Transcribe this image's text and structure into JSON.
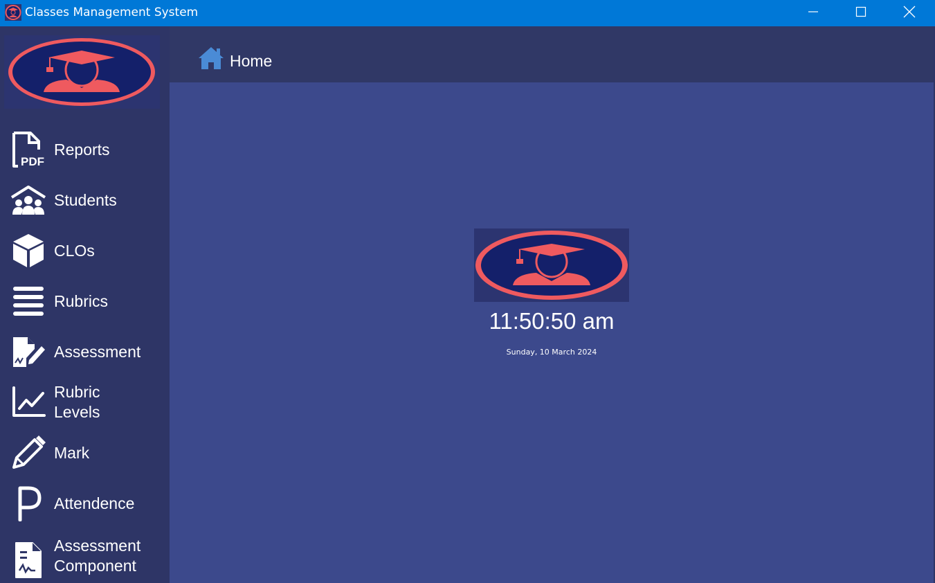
{
  "window": {
    "title": "Classes Management System",
    "titlebar_color": "#0078d7"
  },
  "sidebar": {
    "items": [
      {
        "label": "Reports",
        "icon": "pdf-file-icon"
      },
      {
        "label": "Students",
        "icon": "students-icon"
      },
      {
        "label": "CLOs",
        "icon": "cube-icon"
      },
      {
        "label": "Rubrics",
        "icon": "list-icon"
      },
      {
        "label": "Assessment",
        "icon": "assessment-icon"
      },
      {
        "label": "Rubric\nLevels",
        "icon": "line-chart-icon"
      },
      {
        "label": "Mark",
        "icon": "pencil-icon"
      },
      {
        "label": "Attendence",
        "icon": "letter-p-icon"
      },
      {
        "label": "Assessment\nComponent",
        "icon": "document-signature-icon"
      }
    ]
  },
  "header": {
    "title": "Home",
    "icon": "home-icon"
  },
  "main": {
    "time": "11:50:50 am",
    "date": "Sunday, 10 March 2024"
  },
  "colors": {
    "sidebar": "#2e3566",
    "header": "#303866",
    "main": "#3c498c",
    "logo_ring": "#ef5a5f",
    "logo_fill": "#14206a"
  }
}
